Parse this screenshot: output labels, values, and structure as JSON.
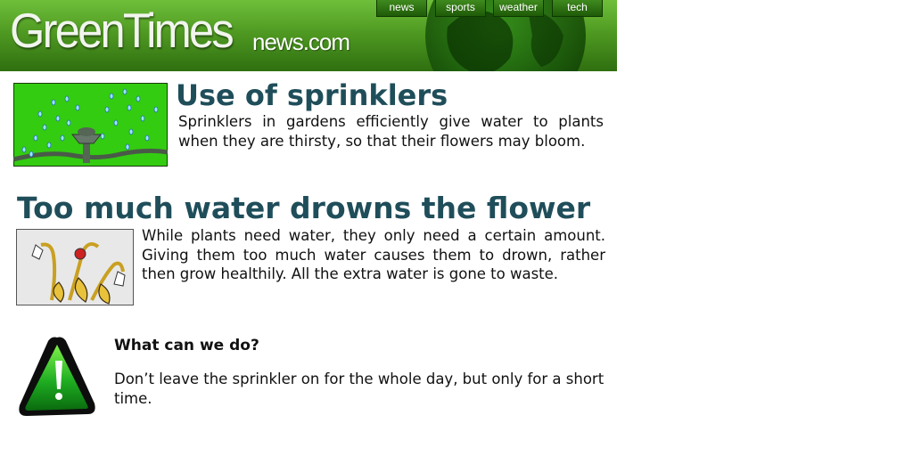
{
  "header": {
    "brand_main": "GreenTimes",
    "brand_suffix": "news.com",
    "nav": [
      "news",
      "sports",
      "weather",
      "tech"
    ]
  },
  "article1": {
    "title": "Use of sprinklers",
    "body": "Sprinklers in gardens efficiently give water to plants when they are thirsty, so that their flowers may bloom."
  },
  "article2": {
    "title": "Too much water drowns the flower",
    "body": "While plants need water, they only need a certain amount. Giving them too much water causes them to drown, rather then grow healthily. All the extra water is gone to waste."
  },
  "tip": {
    "heading": "What can we do?",
    "body": "Don’t leave the sprinkler on for the whole day, but only for a short time."
  },
  "colors": {
    "header_green": "#4f9a22",
    "title_color": "#1f4e5a",
    "sprinkler_bg": "#33cc11"
  }
}
